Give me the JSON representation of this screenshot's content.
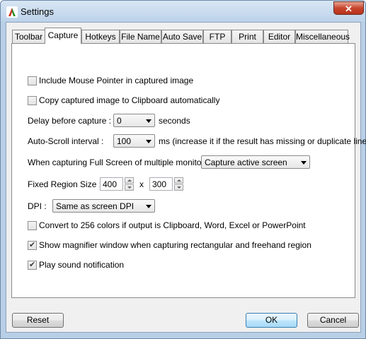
{
  "window": {
    "title": "Settings",
    "close_label": "✕"
  },
  "tabs": [
    {
      "label": "Toolbar"
    },
    {
      "label": "Capture",
      "active": true
    },
    {
      "label": "Hotkeys"
    },
    {
      "label": "File Name"
    },
    {
      "label": "Auto Save"
    },
    {
      "label": "FTP"
    },
    {
      "label": "Print"
    },
    {
      "label": "Editor"
    },
    {
      "label": "Miscellaneous"
    }
  ],
  "capture": {
    "include_pointer": {
      "label": "Include Mouse Pointer in captured image",
      "checked": false
    },
    "copy_clipboard": {
      "label": "Copy captured image to Clipboard automatically",
      "checked": false
    },
    "delay": {
      "label": "Delay before capture :",
      "value": "0",
      "unit": "seconds"
    },
    "autoscroll": {
      "label": "Auto-Scroll interval :",
      "value": "100",
      "unit": "ms (increase it if the result has missing or duplicate lines)"
    },
    "multi_monitor": {
      "label": "When capturing Full Screen of multiple monitors :",
      "value": "Capture active screen"
    },
    "fixed_region": {
      "label": "Fixed Region Size :",
      "width": "400",
      "separator": "x",
      "height": "300"
    },
    "dpi": {
      "label": "DPI :",
      "value": "Same as screen DPI"
    },
    "convert_256": {
      "label": "Convert to 256 colors if output is Clipboard, Word, Excel or PowerPoint",
      "checked": false
    },
    "magnifier": {
      "label": "Show magnifier window when capturing rectangular and freehand region",
      "checked": true
    },
    "sound": {
      "label": "Play sound notification",
      "checked": true
    }
  },
  "buttons": {
    "reset": "Reset",
    "ok": "OK",
    "cancel": "Cancel"
  },
  "colors": {
    "accent": "#3c7fb1",
    "close": "#c7452d"
  },
  "icons": {
    "app": "app-logo-icon",
    "close": "close-icon"
  }
}
